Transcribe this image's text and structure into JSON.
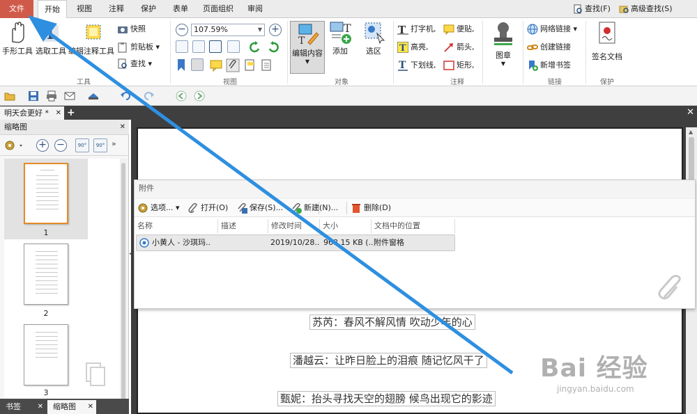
{
  "menu": {
    "file": "文件",
    "tabs": [
      "开始",
      "视图",
      "注释",
      "保护",
      "表单",
      "页面组织",
      "审阅"
    ],
    "find": "查找(F)",
    "advanced_find": "高级查找(S)"
  },
  "ribbon": {
    "tools_group": "工具",
    "hand_tool": "手形工具",
    "select_tool": "选取工具",
    "annot_tool": "编辑注释工具",
    "snapshot": "快照",
    "clipboard": "剪贴板",
    "find": "查找",
    "zoom": "107.59%",
    "view_group": "视图",
    "edit_content": "编辑内容",
    "add": "添加",
    "select_area": "选区",
    "object_group": "对象",
    "typewriter": "打字机",
    "sticky_note": "便贴",
    "highlight": "高亮",
    "arrow": "箭头",
    "underline": "下划线",
    "rectangle": "矩形",
    "annot_group": "注释",
    "stamp": "图章",
    "web_link": "网络链接",
    "create_link": "创建链接",
    "add_bookmark": "新增书签",
    "link_group": "链接",
    "sign_doc": "签名文档",
    "protect_group": "保护"
  },
  "doc_tab": "明天会更好 *",
  "thumbnail_panel": {
    "title": "缩略图",
    "pages": [
      "1",
      "2",
      "3"
    ],
    "bottom_tabs": [
      "书签",
      "缩略图"
    ]
  },
  "attachments": {
    "title": "附件",
    "toolbar": {
      "options": "选项...",
      "open": "打开(O)",
      "save": "保存(S)...",
      "new": "新建(N)...",
      "delete": "删除(D)"
    },
    "columns": [
      "名称",
      "描述",
      "修改时间",
      "大小",
      "文档中的位置"
    ],
    "rows": [
      {
        "name": "小黄人 - 沙琪玛..",
        "desc": "",
        "modified": "2019/10/28..",
        "size": "968.15 KB (..",
        "location": "附件窗格"
      }
    ]
  },
  "document": {
    "lines": [
      "苏芮：春风不解风情 吹动少年的心",
      "潘越云：让昨日脸上的泪痕 随记忆风干了",
      "甄妮：抬头寻找天空的翅膀 候鸟出现它的影迹"
    ]
  },
  "watermark": {
    "brand": "Bai 经验",
    "url": "jingyan.baidu.com"
  },
  "colors": {
    "file_tab": "#d05a4a",
    "arrow": "#2e8fe0"
  }
}
